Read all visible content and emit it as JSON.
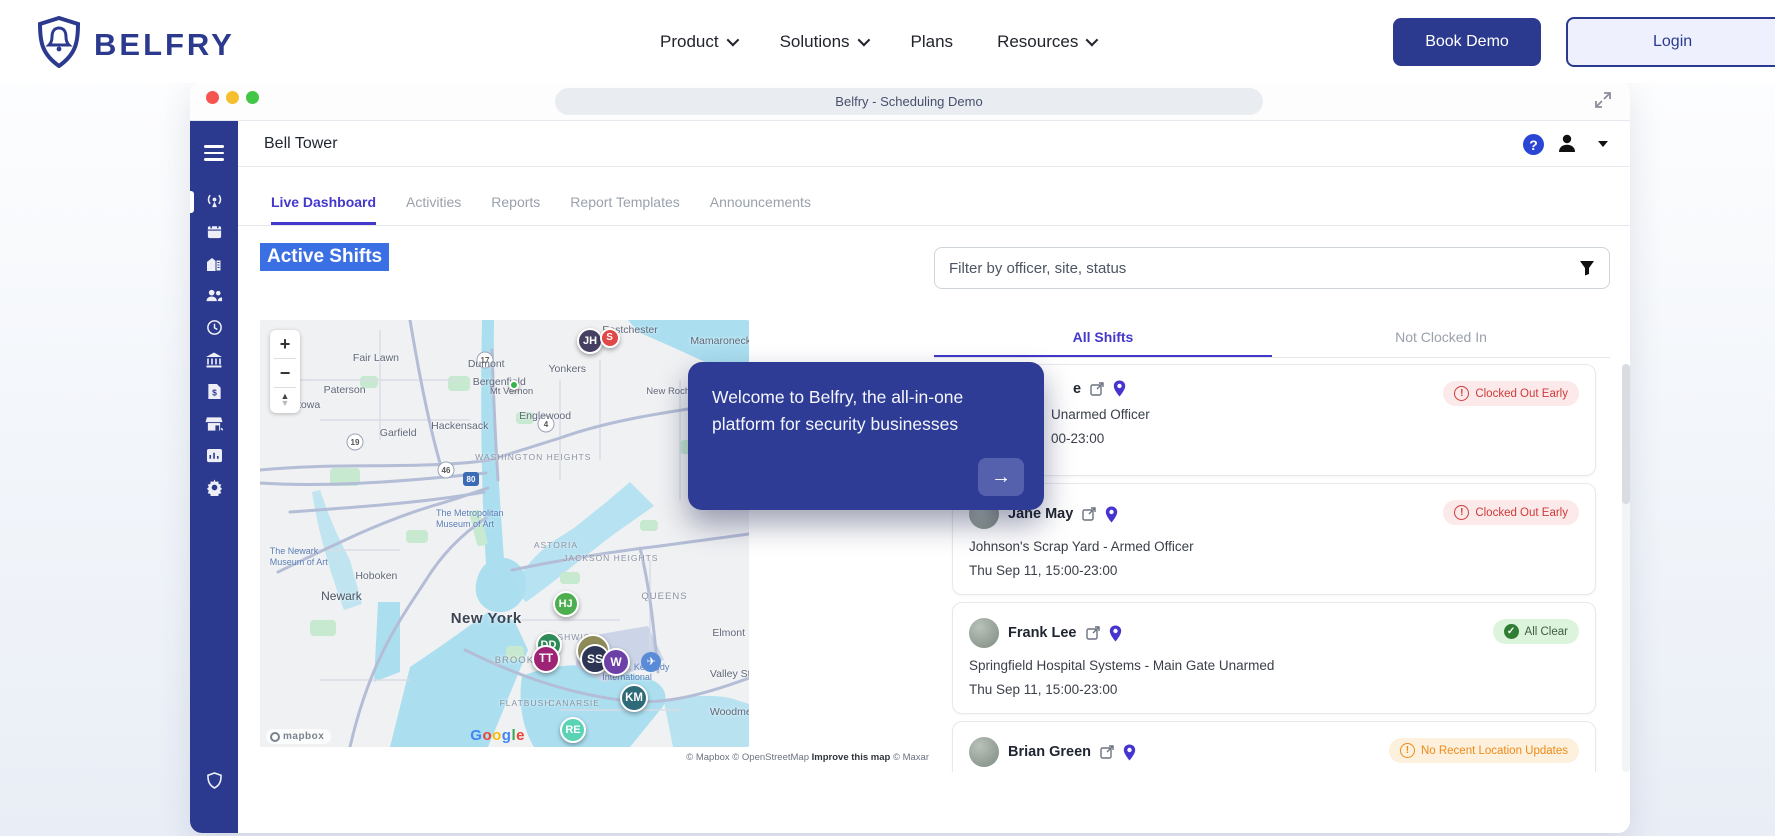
{
  "theme": {
    "brand_indigo": "#2b3a8f",
    "active_tab_indigo": "#4338ca",
    "selection_blue": "#3b6fe4",
    "danger_red": "#cf3a3a",
    "success_green": "#2e7d32",
    "warning_orange": "#ed8b18"
  },
  "top_nav": {
    "brand": "BELFRY",
    "items": [
      {
        "label": "Product",
        "dropdown": true
      },
      {
        "label": "Solutions",
        "dropdown": true
      },
      {
        "label": "Plans",
        "dropdown": false
      },
      {
        "label": "Resources",
        "dropdown": true
      }
    ],
    "book_demo_label": "Book Demo",
    "login_label": "Login"
  },
  "browser": {
    "title": "Belfry - Scheduling Demo",
    "traffic_lights": {
      "red": "#f4564f",
      "yellow": "#f6bf30",
      "green": "#43c645"
    }
  },
  "app": {
    "header": {
      "title": "Bell Tower"
    },
    "sidebar_icons": [
      "menu",
      "live-broadcast",
      "calendar",
      "site-building",
      "team-people",
      "clock",
      "bank",
      "invoice-doc",
      "storefront",
      "report-card",
      "settings-gear",
      "shield"
    ],
    "tabs": [
      "Live Dashboard",
      "Activities",
      "Reports",
      "Report Templates",
      "Announcements"
    ],
    "section_title": "Active Shifts",
    "filter_placeholder": "Filter by officer, site, status",
    "tooltip": {
      "message": "Welcome to Belfry, the all-in-one platform for security businesses",
      "next_icon": "arrow-right",
      "arrow": "→"
    },
    "map": {
      "labels": [
        "Eastchester",
        "Mamaroneck",
        "Fair Lawn",
        "Dumont",
        "Yonkers",
        "Bergenfield",
        "Paterson",
        "Mt Vernon",
        "New Rochelle",
        "Totowa",
        "Englewood",
        "Hackensack",
        "Garfield",
        "WASHINGTON HEIGHTS",
        "The Metropolitan Museum of Art",
        "ASTORIA",
        "JACKSON HEIGHTS",
        "Hoboken",
        "The Newark Museum of Art",
        "Newark",
        "New York",
        "QUEENS",
        "BUSHWICK",
        "BROOKLYN",
        "FLATBUSH",
        "CANARSIE",
        "Elmont",
        "Valley Stream",
        "Woodmere",
        "John F. Kennedy International"
      ],
      "shields": [
        "17",
        "19",
        "46",
        "4",
        "80"
      ],
      "airport_glyph": "✈",
      "markers": [
        {
          "initials": "JH",
          "color": "#454063"
        },
        {
          "initials": "S",
          "color": "#e04848"
        },
        {
          "initials": "",
          "color": "#35b24a"
        },
        {
          "initials": "HJ",
          "color": "#4cae4f"
        },
        {
          "initials": "DD",
          "color": "#2e8b57"
        },
        {
          "initials": "TT",
          "color": "#9e2374"
        },
        {
          "initials": "",
          "color": "#8f8c5a"
        },
        {
          "initials": "SS",
          "color": "#2c3554"
        },
        {
          "initials": "W",
          "color": "#6d40a8"
        },
        {
          "initials": "KM",
          "color": "#2f6a78"
        },
        {
          "initials": "RE",
          "color": "#5ad2b4"
        }
      ],
      "google_logo": [
        "G",
        "o",
        "o",
        "g",
        "l",
        "e"
      ],
      "mapbox_logo": "mapbox",
      "attribution": {
        "mapbox": "© Mapbox",
        "osm": "© OpenStreetMap",
        "improve": "Improve this map",
        "maxar": "© Maxar"
      }
    },
    "shifts_panel": {
      "tabs": [
        "All Shifts",
        "Not Clocked In"
      ],
      "cards": [
        {
          "name_fragment": "e",
          "site_fragment": "Unarmed Officer",
          "time_fragment": "00-23:00",
          "badge": "Clocked Out Early",
          "badge_type": "danger"
        },
        {
          "name": "Jane May",
          "site": "Johnson's Scrap Yard - Armed Officer",
          "time": "Thu Sep 11, 15:00-23:00",
          "badge": "Clocked Out Early",
          "badge_type": "danger"
        },
        {
          "name": "Frank Lee",
          "site": "Springfield Hospital Systems - Main Gate Unarmed",
          "time": "Thu Sep 11, 15:00-23:00",
          "badge": "All Clear",
          "badge_type": "success"
        },
        {
          "name": "Brian Green",
          "badge": "No Recent Location Updates",
          "badge_type": "warning"
        }
      ]
    }
  }
}
